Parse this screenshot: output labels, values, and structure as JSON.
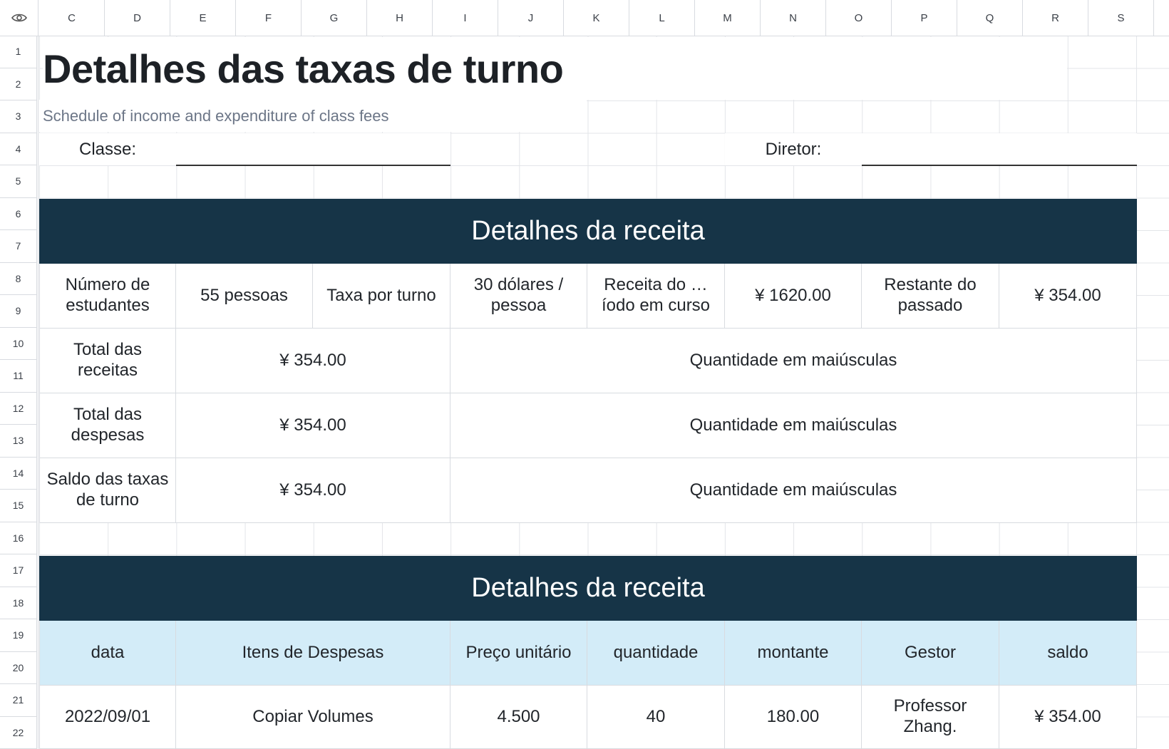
{
  "columns": [
    "C",
    "D",
    "E",
    "F",
    "G",
    "H",
    "I",
    "J",
    "K",
    "L",
    "M",
    "N",
    "O",
    "P",
    "Q",
    "R",
    "S"
  ],
  "rows": [
    "1",
    "2",
    "3",
    "4",
    "5",
    "6",
    "7",
    "8",
    "9",
    "10",
    "11",
    "12",
    "13",
    "14",
    "15",
    "16",
    "17",
    "18",
    "19",
    "20",
    "21",
    "22"
  ],
  "title": "Detalhes das taxas de turno",
  "subtitle": "Schedule of income and expenditure of class fees",
  "class_label": "Classe:",
  "director_label": "Diretor:",
  "income_section": {
    "banner": "Detalhes da receita",
    "stats": [
      {
        "label": "Número de estudantes",
        "value": "55 pessoas"
      },
      {
        "label": "Taxa por turno",
        "value": "30 dólares / pessoa"
      },
      {
        "label": "Receita do …íodo em curso",
        "value": "¥ 1620.00"
      },
      {
        "label": "Restante do passado",
        "value": "¥ 354.00"
      }
    ],
    "totals": [
      {
        "label": "Total das receitas",
        "value": "¥ 354.00",
        "words": "Quantidade em maiúsculas"
      },
      {
        "label": "Total das despesas",
        "value": "¥ 354.00",
        "words": "Quantidade em maiúsculas"
      },
      {
        "label": "Saldo das taxas de turno",
        "value": "¥ 354.00",
        "words": "Quantidade em maiúsculas"
      }
    ]
  },
  "expense_section": {
    "banner": "Detalhes da receita",
    "headers": [
      "data",
      "Itens de Despesas",
      "Preço unitário",
      "quantidade",
      "montante",
      "Gestor",
      "saldo"
    ],
    "rows": [
      [
        "2022/09/01",
        "Copiar Volumes",
        "4.500",
        "40",
        "180.00",
        "Professor Zhang.",
        "¥ 354.00"
      ]
    ]
  }
}
